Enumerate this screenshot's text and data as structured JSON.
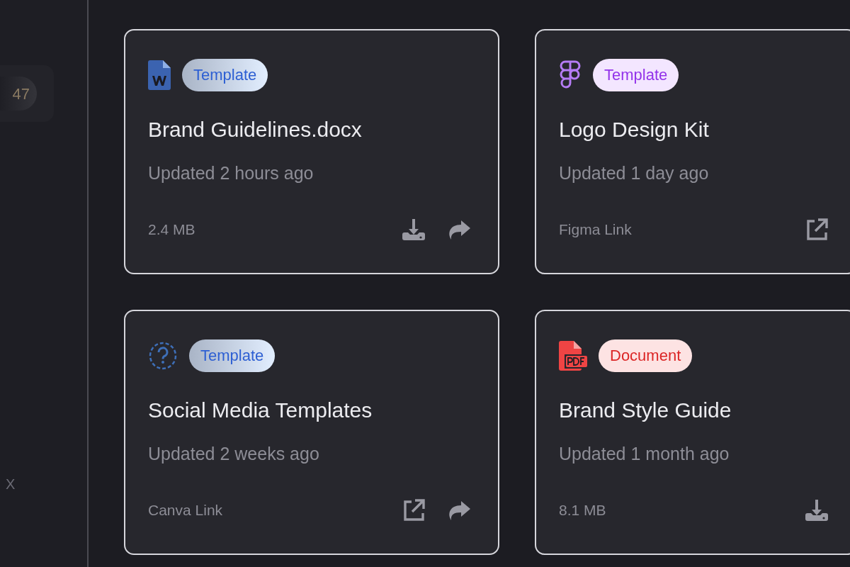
{
  "sidebar": {
    "badge": "47",
    "close": "X"
  },
  "cards": [
    {
      "kind": "word",
      "badge": {
        "label": "Template",
        "color": "#2d5fd3"
      },
      "title": "Brand Guidelines.docx",
      "updated": "Updated 2 hours ago",
      "meta": "2.4 MB",
      "actions": [
        {
          "kind": "download"
        },
        {
          "kind": "share"
        }
      ]
    },
    {
      "kind": "figma",
      "badge": {
        "label": "Template",
        "color": "#9333ea"
      },
      "title": "Logo Design Kit",
      "updated": "Updated 1 day ago",
      "meta": "Figma Link",
      "actions": [
        {
          "kind": "external"
        }
      ]
    },
    {
      "kind": "unknown",
      "badge": {
        "label": "Template",
        "color": "#2d5fd3"
      },
      "title": "Social Media Templates",
      "updated": "Updated 2 weeks ago",
      "meta": "Canva Link",
      "actions": [
        {
          "kind": "external"
        },
        {
          "kind": "share"
        }
      ]
    },
    {
      "kind": "pdf",
      "badge": {
        "label": "Document",
        "color": "#dc2626"
      },
      "title": "Brand Style Guide",
      "updated": "Updated 1 month ago",
      "meta": "8.1 MB",
      "actions": [
        {
          "kind": "download"
        }
      ]
    }
  ]
}
